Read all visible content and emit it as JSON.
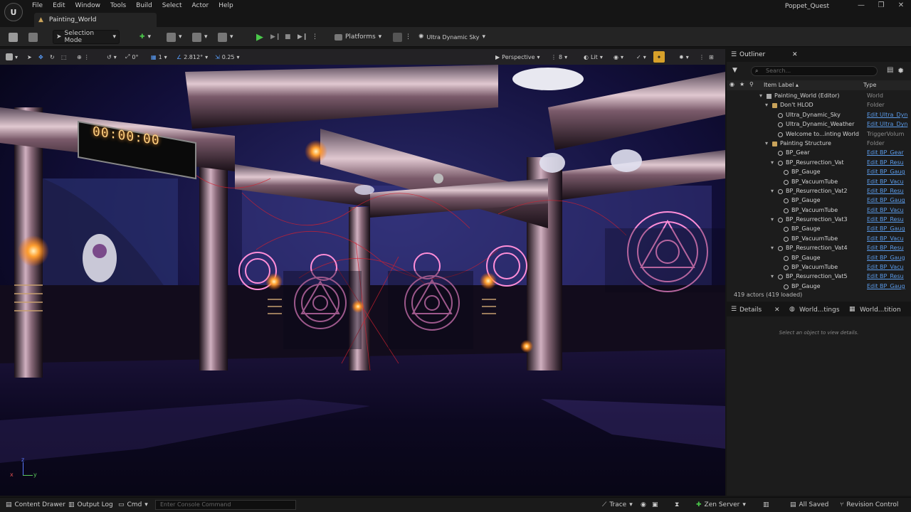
{
  "app": {
    "project_name": "Poppet_Quest",
    "menu": [
      "File",
      "Edit",
      "Window",
      "Tools",
      "Build",
      "Select",
      "Actor",
      "Help"
    ],
    "map_tab": "Painting_World"
  },
  "toolbar": {
    "selection_mode": "Selection Mode",
    "platforms": "Platforms",
    "sky": "Ultra Dynamic Sky"
  },
  "viewport": {
    "rotation_snap": "0°",
    "scale_snap_grid": "1",
    "angle": "2.812°",
    "scale": "0.25",
    "perspective": "Perspective",
    "speed": "8",
    "lit": "Lit",
    "clock": "00:00:00",
    "axis_z": "z",
    "axis_x": "x",
    "axis_y": "y"
  },
  "outliner": {
    "title": "Outliner",
    "search_placeholder": "Search...",
    "col_label": "Item Label ▴",
    "col_type": "Type",
    "rows": [
      {
        "label": "Painting_World (Editor)",
        "type": "World",
        "indent": 0,
        "icon": "world",
        "expand": "▾",
        "link": false
      },
      {
        "label": "Don't HLOD",
        "type": "Folder",
        "indent": 1,
        "icon": "folder",
        "expand": "▾",
        "link": false
      },
      {
        "label": "Ultra_Dynamic_Sky",
        "type": "Edit Ultra_Dyn",
        "indent": 2,
        "icon": "actor",
        "expand": "",
        "link": true
      },
      {
        "label": "Ultra_Dynamic_Weather",
        "type": "Edit Ultra_Dyn",
        "indent": 2,
        "icon": "actor",
        "expand": "",
        "link": true
      },
      {
        "label": "Welcome to...inting World",
        "type": "TriggerVolum",
        "indent": 2,
        "icon": "actor",
        "expand": "",
        "link": false
      },
      {
        "label": "Painting Structure",
        "type": "Folder",
        "indent": 1,
        "icon": "folder",
        "expand": "▾",
        "link": false
      },
      {
        "label": "BP_Gear",
        "type": "Edit BP_Gear",
        "indent": 2,
        "icon": "actor",
        "expand": "",
        "link": true
      },
      {
        "label": "BP_Resurrection_Vat",
        "type": "Edit BP_Resu",
        "indent": 2,
        "icon": "actor",
        "expand": "▾",
        "link": true
      },
      {
        "label": "BP_Gauge",
        "type": "Edit BP_Gaug",
        "indent": 3,
        "icon": "actor",
        "expand": "",
        "link": true
      },
      {
        "label": "BP_VacuumTube",
        "type": "Edit BP_Vacu",
        "indent": 3,
        "icon": "actor",
        "expand": "",
        "link": true
      },
      {
        "label": "BP_Resurrection_Vat2",
        "type": "Edit BP_Resu",
        "indent": 2,
        "icon": "actor",
        "expand": "▾",
        "link": true
      },
      {
        "label": "BP_Gauge",
        "type": "Edit BP_Gaug",
        "indent": 3,
        "icon": "actor",
        "expand": "",
        "link": true
      },
      {
        "label": "BP_VacuumTube",
        "type": "Edit BP_Vacu",
        "indent": 3,
        "icon": "actor",
        "expand": "",
        "link": true
      },
      {
        "label": "BP_Resurrection_Vat3",
        "type": "Edit BP_Resu",
        "indent": 2,
        "icon": "actor",
        "expand": "▾",
        "link": true
      },
      {
        "label": "BP_Gauge",
        "type": "Edit BP_Gaug",
        "indent": 3,
        "icon": "actor",
        "expand": "",
        "link": true
      },
      {
        "label": "BP_VacuumTube",
        "type": "Edit BP_Vacu",
        "indent": 3,
        "icon": "actor",
        "expand": "",
        "link": true
      },
      {
        "label": "BP_Resurrection_Vat4",
        "type": "Edit BP_Resu",
        "indent": 2,
        "icon": "actor",
        "expand": "▾",
        "link": true
      },
      {
        "label": "BP_Gauge",
        "type": "Edit BP_Gaug",
        "indent": 3,
        "icon": "actor",
        "expand": "",
        "link": true
      },
      {
        "label": "BP_VacuumTube",
        "type": "Edit BP_Vacu",
        "indent": 3,
        "icon": "actor",
        "expand": "",
        "link": true
      },
      {
        "label": "BP_Resurrection_Vat5",
        "type": "Edit BP_Resu",
        "indent": 2,
        "icon": "actor",
        "expand": "▾",
        "link": true
      },
      {
        "label": "BP_Gauge",
        "type": "Edit BP_Gaug",
        "indent": 3,
        "icon": "actor",
        "expand": "",
        "link": true
      }
    ],
    "actor_count": "419 actors (419 loaded)"
  },
  "details": {
    "tab_details": "Details",
    "tab_world_settings": "World...tings",
    "tab_world_partition": "World...tition",
    "empty_message": "Select an object to view details."
  },
  "bottombar": {
    "content_drawer": "Content Drawer",
    "output_log": "Output Log",
    "cmd": "Cmd",
    "console_placeholder": "Enter Console Command",
    "trace": "Trace",
    "zen_server": "Zen Server",
    "all_saved": "All Saved",
    "revision_control": "Revision Control"
  },
  "colors": {
    "accent_play": "#4ac94a",
    "link": "#5a9ae8",
    "panel": "#1c1c1c",
    "sigil": "#ff8ed8"
  },
  "icons": [
    "unreal-logo-icon",
    "save-icon",
    "play-icon",
    "pause-icon",
    "stop-icon",
    "eject-icon",
    "search-icon",
    "eye-icon",
    "star-icon",
    "folder-icon",
    "close-icon",
    "filter-icon",
    "settings-icon"
  ]
}
